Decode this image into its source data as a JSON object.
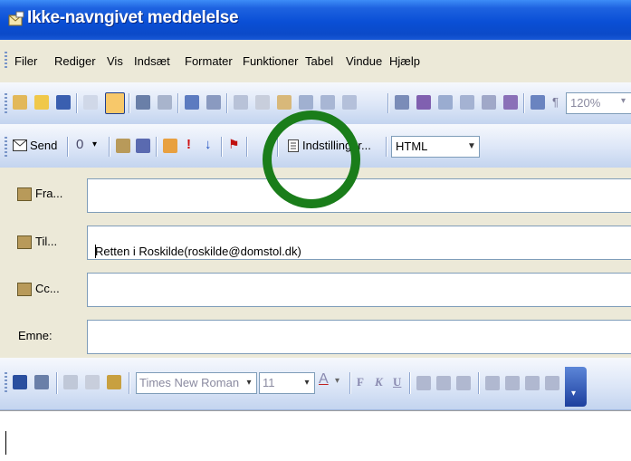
{
  "window": {
    "title": "Ikke-navngivet meddelelse"
  },
  "menu": [
    "Filer",
    "Rediger",
    "Vis",
    "Indsæt",
    "Formater",
    "Funktioner",
    "Tabel",
    "Vindue",
    "Hjælp"
  ],
  "toolbar_standard": {
    "zoom": "120%"
  },
  "toolbar_email": {
    "send_label": "Send",
    "options_label": "Indstillinger...",
    "format_value": "HTML"
  },
  "fields": {
    "from_label": "Fra...",
    "to_label": "Til...",
    "to_value": "Retten i Roskilde(roskilde@domstol.dk)",
    "cc_label": "Cc...",
    "subject_label": "Emne:"
  },
  "format_toolbar": {
    "font": "Times New Roman",
    "size": "11",
    "bold": "F",
    "italic": "K",
    "underline": "U",
    "font_color_glyph": "A"
  },
  "colors": {
    "title_bar": "#0b4ac8",
    "highlight_circle": "#1a7d1a"
  }
}
